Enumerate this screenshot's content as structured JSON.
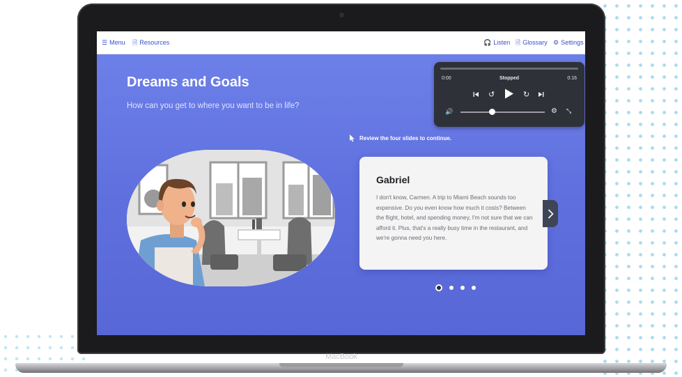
{
  "device": {
    "brand": "MacBook"
  },
  "topbar": {
    "menu_label": "Menu",
    "resources_label": "Resources",
    "listen_label": "Listen",
    "glossary_label": "Glossary",
    "settings_label": "Settings"
  },
  "page": {
    "title": "Dreams and Goals",
    "subtitle": "How can you get to where you want to be in life?",
    "instruction": "Review the four slides to continue."
  },
  "player": {
    "time_current": "0:00",
    "status": "Stopped",
    "time_total": "0:16",
    "volume_level": 0.38
  },
  "slide": {
    "speaker": "Gabriel",
    "text": "I don't know, Carmen. A trip to Miami Beach sounds too expensive. Do you even know how much it costs? Between the flight, hotel, and spending money, I'm not sure that we can afford it. Plus, that's a really busy time in the restaurant, and we're gonna need you here."
  },
  "pager": {
    "total": 4,
    "current": 1
  },
  "colors": {
    "background_blue": "#6a7ce6",
    "accent_blue": "#3b50c8",
    "player_bg": "#2f3138",
    "card_bg": "#f4f4f5",
    "dots": "#a9dcef"
  }
}
